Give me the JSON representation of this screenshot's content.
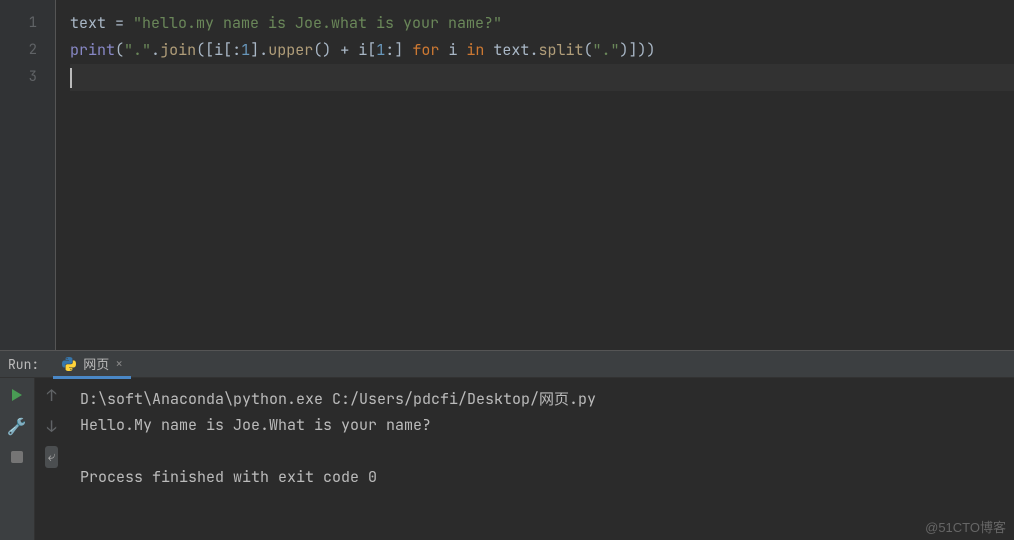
{
  "editor": {
    "gutter": [
      "1",
      "2",
      "3"
    ],
    "lines": [
      [
        {
          "c": "tk-local",
          "t": "text"
        },
        {
          "c": "tk-op",
          "t": " = "
        },
        {
          "c": "tk-str",
          "t": "\"hello.my name is Joe.what is your name?\""
        }
      ],
      [
        {
          "c": "tk-builtin",
          "t": "print"
        },
        {
          "c": "tk-paren",
          "t": "("
        },
        {
          "c": "tk-str",
          "t": "\".\""
        },
        {
          "c": "tk-op",
          "t": "."
        },
        {
          "c": "tk-call",
          "t": "join"
        },
        {
          "c": "tk-paren",
          "t": "(["
        },
        {
          "c": "tk-local",
          "t": "i"
        },
        {
          "c": "tk-paren",
          "t": "["
        },
        {
          "c": "tk-op",
          "t": ":"
        },
        {
          "c": "tk-num",
          "t": "1"
        },
        {
          "c": "tk-paren",
          "t": "]"
        },
        {
          "c": "tk-op",
          "t": "."
        },
        {
          "c": "tk-call",
          "t": "upper"
        },
        {
          "c": "tk-paren",
          "t": "()"
        },
        {
          "c": "tk-op",
          "t": " + "
        },
        {
          "c": "tk-local",
          "t": "i"
        },
        {
          "c": "tk-paren",
          "t": "["
        },
        {
          "c": "tk-num",
          "t": "1"
        },
        {
          "c": "tk-op",
          "t": ":"
        },
        {
          "c": "tk-paren",
          "t": "]"
        },
        {
          "c": "tk-op",
          "t": " "
        },
        {
          "c": "tk-kw",
          "t": "for"
        },
        {
          "c": "tk-op",
          "t": " "
        },
        {
          "c": "tk-local",
          "t": "i"
        },
        {
          "c": "tk-op",
          "t": " "
        },
        {
          "c": "tk-kw",
          "t": "in"
        },
        {
          "c": "tk-op",
          "t": " "
        },
        {
          "c": "tk-local",
          "t": "text"
        },
        {
          "c": "tk-op",
          "t": "."
        },
        {
          "c": "tk-call",
          "t": "split"
        },
        {
          "c": "tk-paren",
          "t": "("
        },
        {
          "c": "tk-str",
          "t": "\".\""
        },
        {
          "c": "tk-paren",
          "t": ")]))"
        }
      ]
    ]
  },
  "run_panel": {
    "title": "Run:",
    "tab_name": "网页",
    "console_lines": [
      "D:\\soft\\Anaconda\\python.exe C:/Users/pdcfi/Desktop/网页.py",
      "Hello.My name is Joe.What is your name?",
      "",
      "Process finished with exit code 0"
    ]
  },
  "watermark": "@51CTO博客"
}
